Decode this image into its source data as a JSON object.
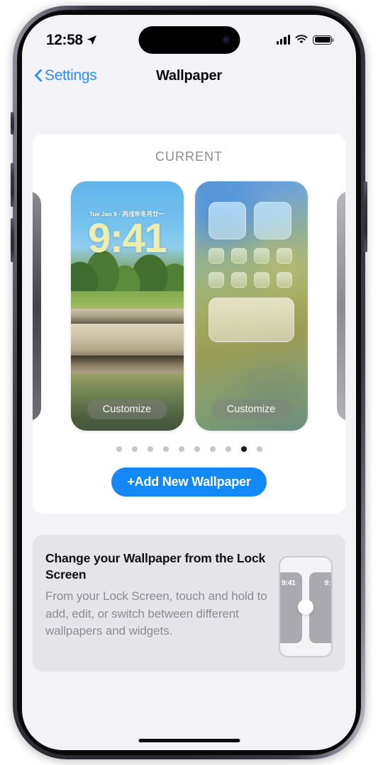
{
  "status_bar": {
    "time": "12:58",
    "location_icon": "location-arrow-icon",
    "signal_icon": "cellular-signal-icon",
    "signal_bars": 4,
    "wifi_icon": "wifi-icon",
    "battery_icon": "battery-icon"
  },
  "nav": {
    "back_label": "Settings",
    "back_icon": "chevron-left-icon",
    "title": "Wallpaper"
  },
  "current_section": {
    "label": "CURRENT",
    "lock_screen": {
      "date": "Tue Jan 9 · 丙戌年冬月廿一",
      "time": "9:41",
      "customize_label": "Customize"
    },
    "home_screen": {
      "customize_label": "Customize"
    },
    "page_dots": {
      "total": 10,
      "active_index": 8
    },
    "add_button_label": "+Add New Wallpaper"
  },
  "info_card": {
    "title": "Change your Wallpaper from the Lock Screen",
    "body": "From your Lock Screen, touch and hold to add, edit, or switch between different wallpapers and widgets.",
    "illustration": {
      "left_time": "9:41",
      "right_time": "9:"
    }
  },
  "colors": {
    "accent_blue": "#1488f5",
    "link_blue": "#2e8bf0",
    "page_background": "#f2f2f7",
    "card_background": "#ffffff",
    "info_card_background": "#e4e4e9",
    "lock_time_yellow": "#ecedb0",
    "secondary_text": "#8c8c92"
  }
}
